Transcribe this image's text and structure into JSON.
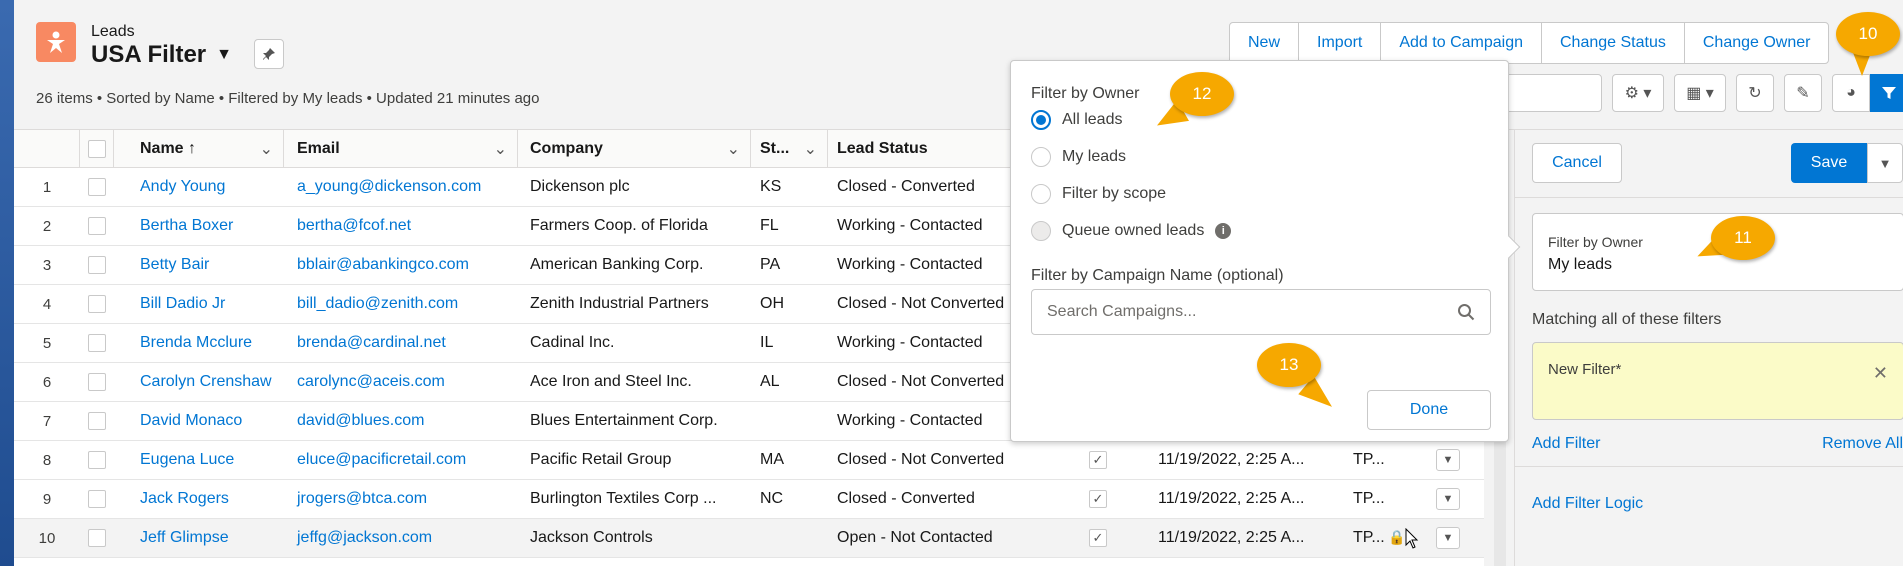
{
  "header": {
    "object_label": "Leads",
    "list_view_name": "USA Filter",
    "meta": "26 items • Sorted by Name • Filtered by My leads • Updated 21 minutes ago",
    "actions": [
      "New",
      "Import",
      "Add to Campaign",
      "Change Status",
      "Change Owner"
    ],
    "accent_color": "#0176d3",
    "object_icon_color": "#f88962"
  },
  "table": {
    "columns": [
      "Name",
      "Email",
      "Company",
      "St...",
      "Lead Status"
    ],
    "rows": [
      {
        "num": "1",
        "name": "Andy Young",
        "email": "a_young@dickenson.com",
        "company": "Dickenson plc",
        "state": "KS",
        "status": "Closed - Converted",
        "date": "",
        "owner": ""
      },
      {
        "num": "2",
        "name": "Bertha Boxer",
        "email": "bertha@fcof.net",
        "company": "Farmers Coop. of Florida",
        "state": "FL",
        "status": "Working - Contacted",
        "date": "",
        "owner": ""
      },
      {
        "num": "3",
        "name": "Betty Bair",
        "email": "bblair@abankingco.com",
        "company": "American Banking Corp.",
        "state": "PA",
        "status": "Working - Contacted",
        "date": "",
        "owner": ""
      },
      {
        "num": "4",
        "name": "Bill Dadio Jr",
        "email": "bill_dadio@zenith.com",
        "company": "Zenith Industrial Partners",
        "state": "OH",
        "status": "Closed - Not Converted",
        "date": "",
        "owner": ""
      },
      {
        "num": "5",
        "name": "Brenda Mcclure",
        "email": "brenda@cardinal.net",
        "company": "Cadinal Inc.",
        "state": "IL",
        "status": "Working - Contacted",
        "date": "",
        "owner": ""
      },
      {
        "num": "6",
        "name": "Carolyn Crenshaw",
        "email": "carolync@aceis.com",
        "company": "Ace Iron and Steel Inc.",
        "state": "AL",
        "status": "Closed - Not Converted",
        "date": "",
        "owner": ""
      },
      {
        "num": "7",
        "name": "David Monaco",
        "email": "david@blues.com",
        "company": "Blues Entertainment Corp.",
        "state": "",
        "status": "Working - Contacted",
        "date": "",
        "owner": ""
      },
      {
        "num": "8",
        "name": "Eugena Luce",
        "email": "eluce@pacificretail.com",
        "company": "Pacific Retail Group",
        "state": "MA",
        "status": "Closed - Not Converted",
        "date": "11/19/2022, 2:25 A...",
        "owner": "TP..."
      },
      {
        "num": "9",
        "name": "Jack Rogers",
        "email": "jrogers@btca.com",
        "company": "Burlington Textiles Corp ...",
        "state": "NC",
        "status": "Closed - Converted",
        "date": "11/19/2022, 2:25 A...",
        "owner": "TP..."
      },
      {
        "num": "10",
        "name": "Jeff Glimpse",
        "email": "jeffg@jackson.com",
        "company": "Jackson Controls",
        "state": "",
        "status": "Open - Not Contacted",
        "date": "11/19/2022, 2:25 A...",
        "owner": "TP..."
      }
    ]
  },
  "popover": {
    "title": "Filter by Owner",
    "options": [
      "All leads",
      "My leads",
      "Filter by scope",
      "Queue owned leads"
    ],
    "selected": "All leads",
    "campaign_label": "Filter by Campaign Name (optional)",
    "campaign_placeholder": "Search Campaigns...",
    "done_label": "Done"
  },
  "filter_panel": {
    "cancel_label": "Cancel",
    "save_label": "Save",
    "owner_label": "Filter by Owner",
    "owner_value": "My leads",
    "matching_label": "Matching all of these filters",
    "new_filter_label": "New Filter*",
    "add_filter_label": "Add Filter",
    "remove_all_label": "Remove All",
    "filter_logic_label": "Add Filter Logic"
  },
  "callouts": [
    "10",
    "11",
    "12",
    "13"
  ]
}
